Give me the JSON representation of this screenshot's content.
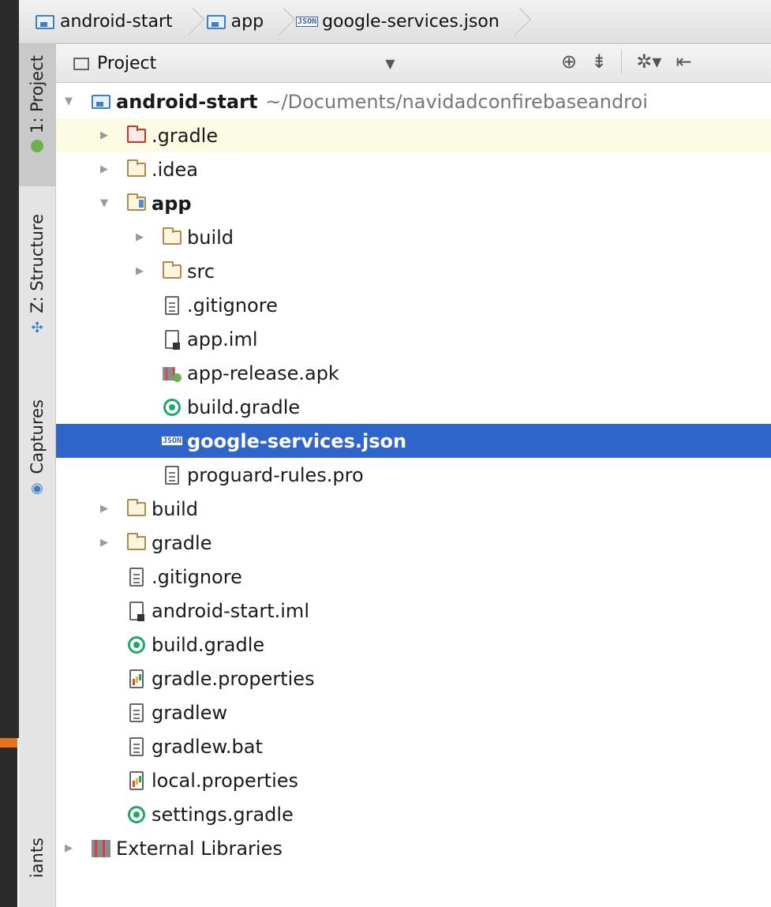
{
  "breadcrumb": {
    "items": [
      "android-start",
      "app",
      "google-services.json"
    ]
  },
  "tool_strip": {
    "project_tab": "1: Project",
    "structure_tab": "Z: Structure",
    "captures_tab": "Captures",
    "variants_tab": "iants"
  },
  "project_view": {
    "title": "Project",
    "dropdown_icon": "chevron-down-icon"
  },
  "tree": {
    "root_label": "android-start",
    "root_path": "~/Documents/navidadconfirebaseandroi",
    "rows": [
      ".gradle",
      ".idea",
      "app",
      "build",
      "src",
      ".gitignore",
      "app.iml",
      "app-release.apk",
      "build.gradle",
      "google-services.json",
      "proguard-rules.pro",
      "build",
      "gradle",
      ".gitignore",
      "android-start.iml",
      "build.gradle",
      "gradle.properties",
      "gradlew",
      "gradlew.bat",
      "local.properties",
      "settings.gradle",
      "External Libraries"
    ]
  },
  "colors": {
    "selection": "#2f65ca",
    "highlight_row": "#fcfbe4",
    "gradle_green": "#1fa86a",
    "folder_brown": "#b08a4c",
    "excluded_red": "#c0392b"
  },
  "peek_text": "),"
}
